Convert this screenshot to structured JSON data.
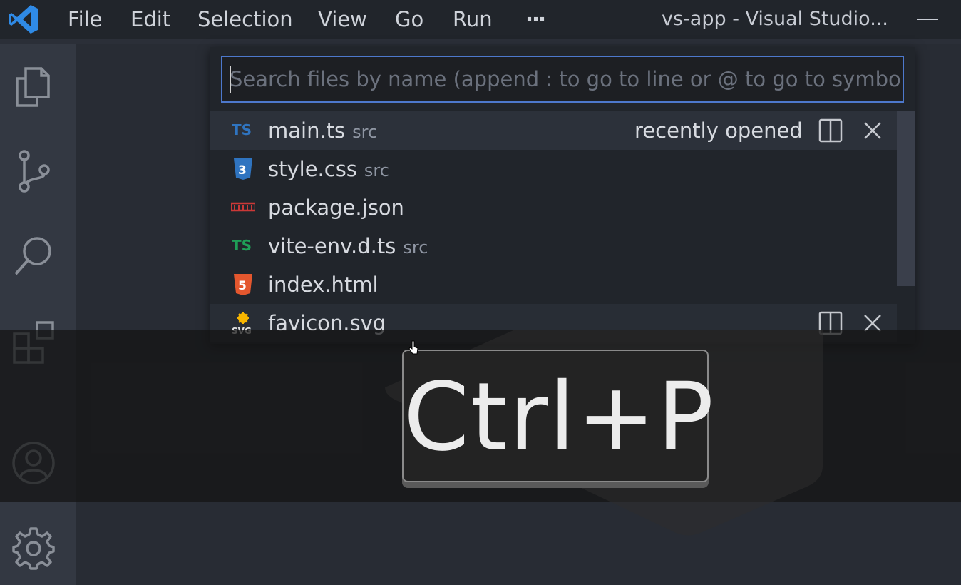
{
  "menubar": {
    "items": [
      "File",
      "Edit",
      "Selection",
      "View",
      "Go",
      "Run"
    ],
    "more": "···",
    "window_title": "vs-app - Visual Studio..."
  },
  "activitybar": {
    "icons": [
      "files-icon",
      "source-control-icon",
      "search-icon",
      "extensions-icon",
      "account-icon",
      "gear-icon"
    ]
  },
  "quick_open": {
    "placeholder": "Search files by name (append : to go to line or @ to go to symbol)",
    "value": "",
    "items": [
      {
        "name": "main.ts",
        "description": "src",
        "icon": "typescript-icon",
        "note": "recently opened"
      },
      {
        "name": "style.css",
        "description": "src",
        "icon": "css-icon"
      },
      {
        "name": "package.json",
        "description": "",
        "icon": "npm-icon"
      },
      {
        "name": "vite-env.d.ts",
        "description": "src",
        "icon": "typescript-def-icon"
      },
      {
        "name": "index.html",
        "description": "",
        "icon": "html-icon"
      },
      {
        "name": "favicon.svg",
        "description": "",
        "icon": "svg-icon"
      }
    ]
  },
  "shortcut_overlay": {
    "keys": "Ctrl+P"
  },
  "colors": {
    "accent_blue": "#4d78cc",
    "ts_blue": "#2f74c0",
    "ts_green": "#1f9e57",
    "html_orange": "#e4572e",
    "npm_red": "#cb3837"
  }
}
